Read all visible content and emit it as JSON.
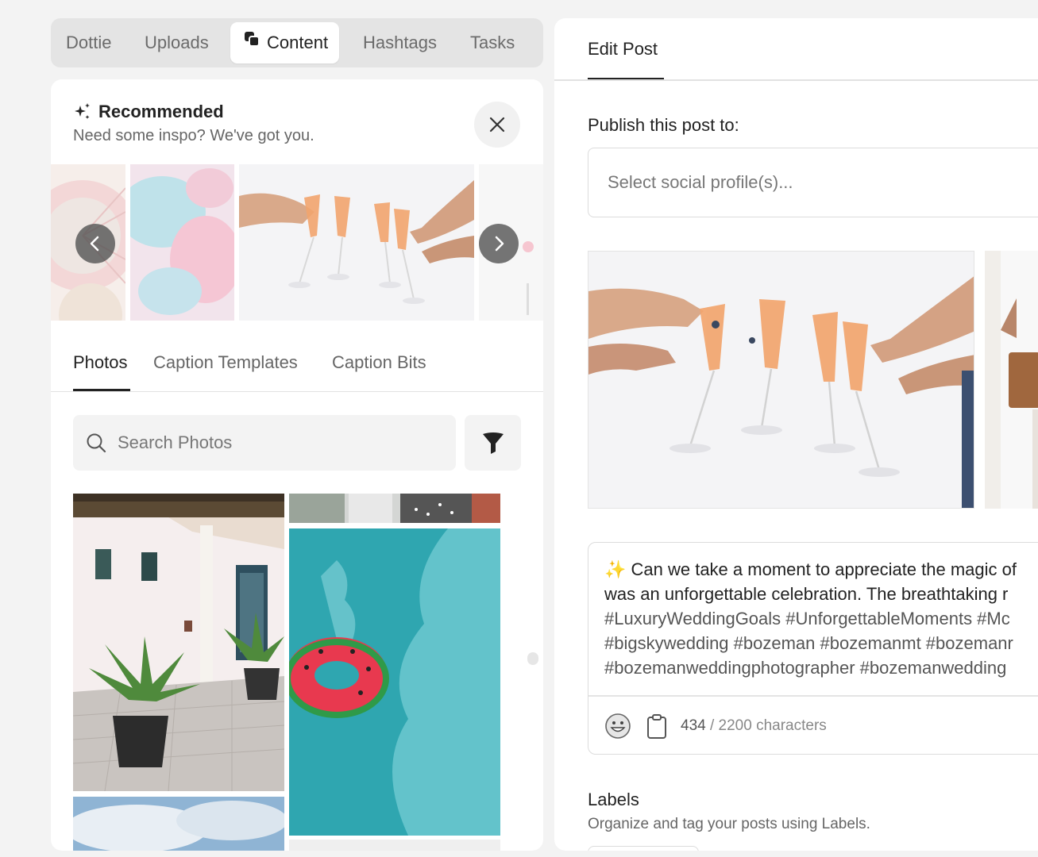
{
  "top_tabs": [
    {
      "label": "Dottie"
    },
    {
      "label": "Uploads"
    },
    {
      "label": "Content"
    },
    {
      "label": "Hashtags"
    },
    {
      "label": "Tasks"
    }
  ],
  "active_top_tab": "Content",
  "recommended": {
    "title": "Recommended",
    "subtitle": "Need some inspo? We've got you."
  },
  "content_tabs": [
    {
      "label": "Photos"
    },
    {
      "label": "Caption Templates"
    },
    {
      "label": "Caption Bits"
    }
  ],
  "active_content_tab": "Photos",
  "search": {
    "placeholder": "Search Photos",
    "value": ""
  },
  "edit_post": {
    "tab_label": "Edit Post",
    "publish_label": "Publish this post to:",
    "profile_placeholder": "Select social profile(s)...",
    "caption_lines": [
      "✨ Can we take a moment to appreciate the magic of",
      "was an unforgettable celebration. The breathtaking r",
      "#LuxuryWeddingGoals #UnforgettableMoments #Mc",
      "#bigskywedding #bozeman #bozemanmt #bozemanr",
      "#bozemanweddingphotographer #bozemanwedding"
    ],
    "char_count": "434",
    "char_limit_text": "/ 2200 characters"
  },
  "labels": {
    "title": "Labels",
    "subtitle": "Organize and tag your posts using Labels."
  },
  "icons": {
    "content_tab": "stacked-squares-icon",
    "recommended": "sparkles-icon",
    "close": "close-icon",
    "prev": "chevron-left-icon",
    "next": "chevron-right-icon",
    "search": "search-icon",
    "filter": "funnel-icon",
    "emoji": "smiley-icon",
    "clipboard": "clipboard-icon"
  }
}
